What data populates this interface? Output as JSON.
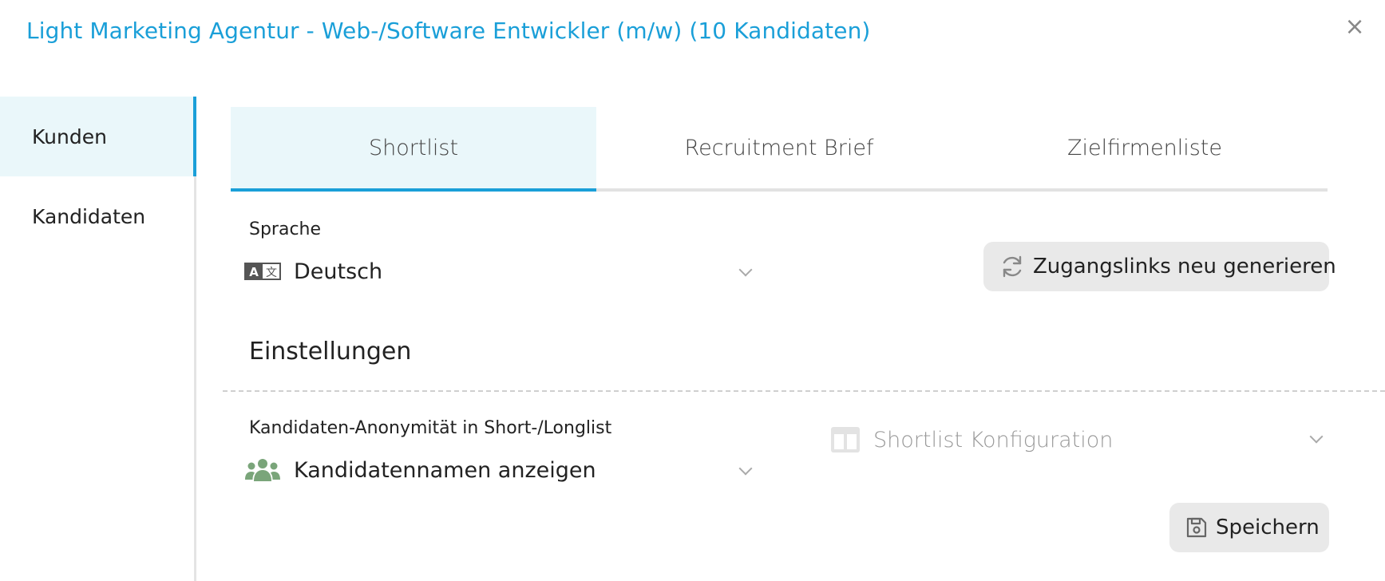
{
  "header": {
    "title": "Light Marketing Agentur - Web-/Software Entwickler (m/w) (10 Kandidaten)",
    "close_icon": "×"
  },
  "sidebar": {
    "items": [
      {
        "label": "Kunden",
        "active": true
      },
      {
        "label": "Kandidaten",
        "active": false
      }
    ]
  },
  "tabs": [
    {
      "label": "Shortlist",
      "active": true
    },
    {
      "label": "Recruitment Brief",
      "active": false
    },
    {
      "label": "Zielfirmenliste",
      "active": false
    }
  ],
  "language": {
    "label": "Sprache",
    "value": "Deutsch",
    "icon": "translate-icon"
  },
  "regenerate_button": {
    "label": "Zugangslinks neu generieren",
    "icon": "refresh-icon"
  },
  "settings": {
    "title": "Einstellungen",
    "anonymity": {
      "label": "Kandidaten-Anonymität in Short-/Longlist",
      "value": "Kandidatennamen anzeigen",
      "icon": "users-icon"
    },
    "shortlist_config": {
      "value": "Shortlist Konfiguration",
      "icon": "columns-icon"
    }
  },
  "save_button": {
    "label": "Speichern",
    "icon": "floppy-icon"
  },
  "colors": {
    "accent": "#1a9fd8",
    "active_bg": "#eaf7fa",
    "users_icon": "#7aa57a",
    "button_bg": "#e9e9e9"
  }
}
